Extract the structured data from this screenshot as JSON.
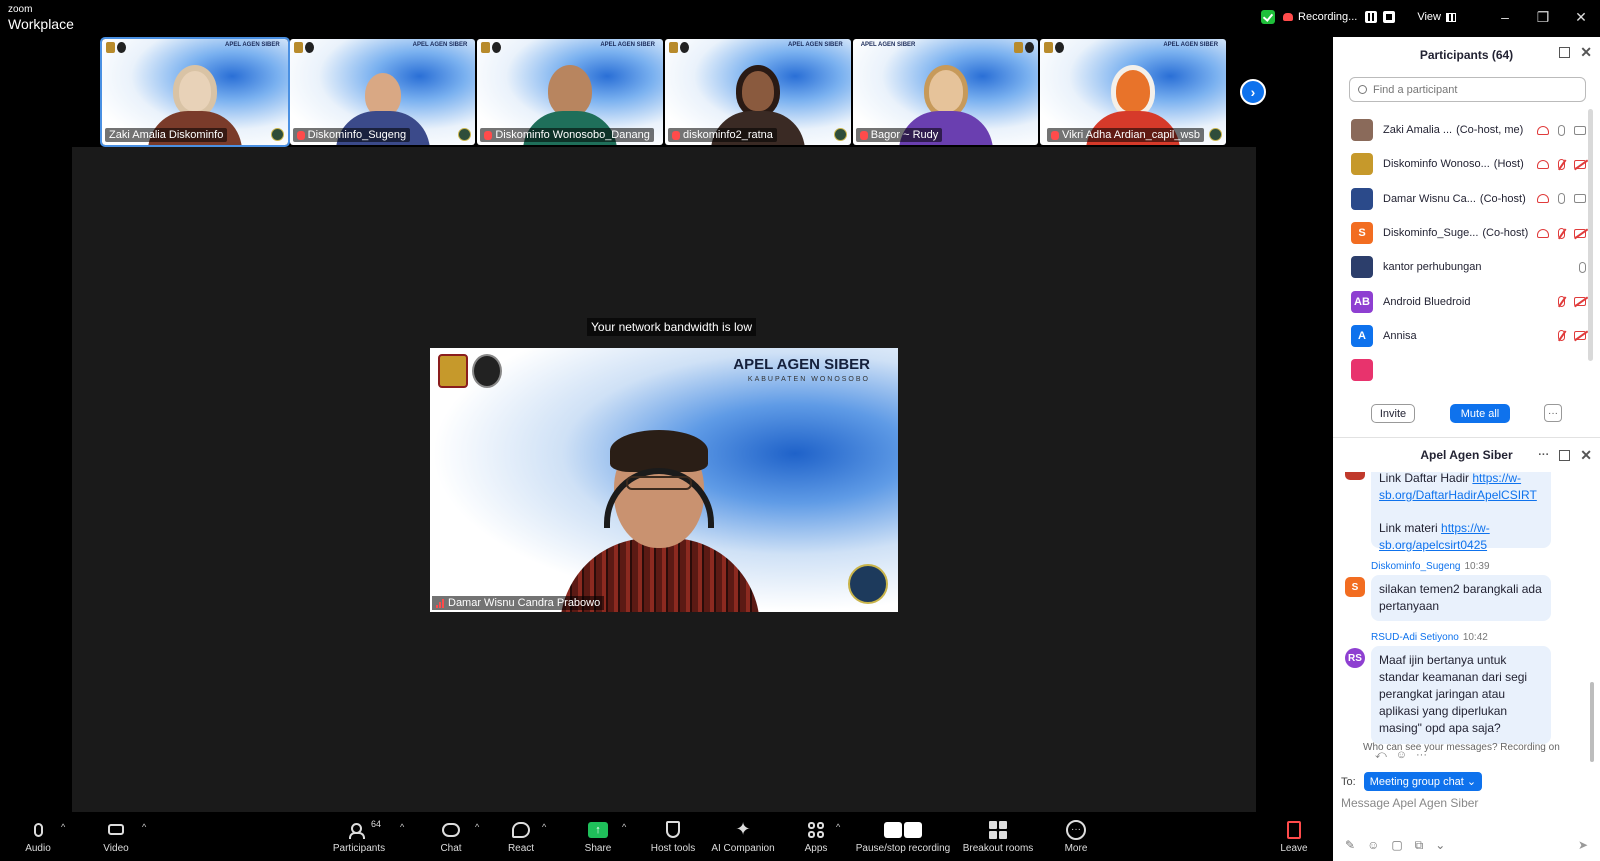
{
  "titlebar": {
    "brand_top": "zoom",
    "brand_bottom": "Workplace",
    "recording_text": "Recording...",
    "view_label": "View"
  },
  "gallery": {
    "tile_tag": "APEL AGEN SIBER",
    "tiles": [
      {
        "name": "Zaki Amalia Diskominfo",
        "muted": false
      },
      {
        "name": "Diskominfo_Sugeng",
        "muted": true
      },
      {
        "name": "Diskominfo Wonosobo_Danang",
        "muted": true
      },
      {
        "name": "diskominfo2_ratna",
        "muted": true
      },
      {
        "name": "Bagor ~ Rudy",
        "muted": true
      },
      {
        "name": "Vikri Adha Ardian_capil_wsb",
        "muted": true
      }
    ]
  },
  "stage": {
    "network_message": "Your network bandwidth is low",
    "speaker_name": "Damar Wisnu Candra Prabowo",
    "slide_title": "APEL AGEN SIBER",
    "slide_subtitle": "KABUPATEN WONOSOBO"
  },
  "toolbar": {
    "audio": "Audio",
    "video": "Video",
    "participants": "Participants",
    "participants_count": "64",
    "chat": "Chat",
    "react": "React",
    "share": "Share",
    "host_tools": "Host tools",
    "ai_companion": "AI Companion",
    "apps": "Apps",
    "pause_stop_recording": "Pause/stop recording",
    "breakout_rooms": "Breakout rooms",
    "more": "More",
    "leave": "Leave"
  },
  "participants_panel": {
    "title": "Participants (64)",
    "search_placeholder": "Find a participant",
    "invite_label": "Invite",
    "mute_all_label": "Mute all",
    "more_label": "···",
    "items": [
      {
        "name": "Zaki Amalia ...",
        "role": "(Co-host, me)",
        "avatar_text": "",
        "avatar_color": "#8a6a5a",
        "mic": "on",
        "cam": "on",
        "sharing": true
      },
      {
        "name": "Diskominfo Wonoso...",
        "role": "(Host)",
        "avatar_text": "",
        "avatar_color": "#c6992b",
        "mic": "off",
        "cam": "off",
        "sharing": true
      },
      {
        "name": "Damar Wisnu Ca...",
        "role": "(Co-host)",
        "avatar_text": "",
        "avatar_color": "#2b4a8a",
        "mic": "on",
        "cam": "on",
        "sharing": true
      },
      {
        "name": "Diskominfo_Suge...",
        "role": "(Co-host)",
        "avatar_text": "S",
        "avatar_color": "#f26d21",
        "mic": "off",
        "cam": "off",
        "sharing": true
      },
      {
        "name": "kantor perhubungan",
        "role": "",
        "avatar_text": "",
        "avatar_color": "#2c3e6b",
        "mic": "on",
        "cam": "none",
        "sharing": false
      },
      {
        "name": "Android Bluedroid",
        "role": "",
        "avatar_text": "AB",
        "avatar_color": "#8e3fd1",
        "mic": "off",
        "cam": "off",
        "sharing": false
      },
      {
        "name": "Annisa",
        "role": "",
        "avatar_text": "A",
        "avatar_color": "#0e72ed",
        "mic": "off",
        "cam": "off",
        "sharing": false
      },
      {
        "name": "",
        "role": "",
        "avatar_text": "",
        "avatar_color": "#e8336d",
        "mic": "none",
        "cam": "none",
        "sharing": false
      }
    ]
  },
  "chat_panel": {
    "title": "Apel Agen Siber",
    "messages": [
      {
        "sender": "",
        "time": "",
        "lines": [
          "Link Daftar Hadir",
          "https://w-sb.org/DaftarHadirApelCSIRT"
        ],
        "link_label_1": "Link Daftar Hadir ",
        "link_1": "https://w-sb.org/DaftarHadirApelCSIRT",
        "link_label_2": "Link materi ",
        "link_2": "https://w-sb.org/apelcsirt0425"
      },
      {
        "sender": "Diskominfo_Sugeng",
        "time": "10:39",
        "avatar_text": "S",
        "avatar_color": "#f26d21",
        "text": "silakan temen2 barangkali ada pertanyaan"
      },
      {
        "sender": "RSUD-Adi Setiyono",
        "time": "10:42",
        "avatar_text": "RS",
        "avatar_color": "#8e3fd1",
        "text": "Maaf ijin bertanya untuk standar keamanan dari segi perangkat jaringan atau aplikasi yang diperlukan masing\" opd apa saja?"
      }
    ],
    "visibility_note": "Who can see your messages? Recording on",
    "to_label": "To:",
    "recipient": "Meeting group chat",
    "input_placeholder": "Message Apel Agen Siber"
  }
}
